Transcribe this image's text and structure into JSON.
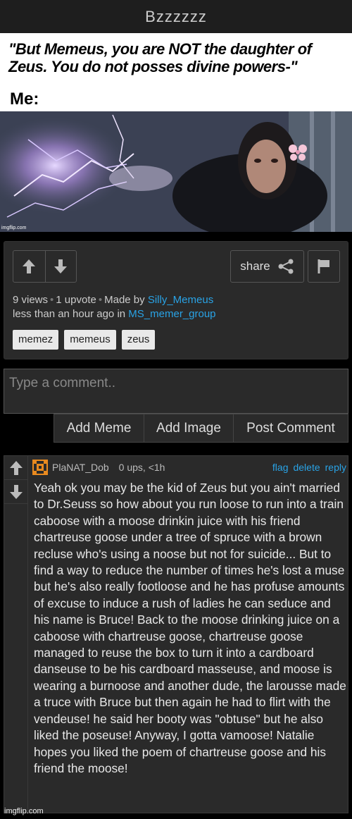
{
  "header": {
    "title": "Bzzzzzz"
  },
  "meme": {
    "caption": "\"But Memeus, you are NOT the daughter of Zeus. You do not posses divine powers-\"",
    "me_label": "Me:",
    "watermark": "imgflip.com"
  },
  "post": {
    "upvote_icon": "arrow-up-icon",
    "downvote_icon": "arrow-down-icon",
    "share_label": "share",
    "views": "9 views",
    "upvotes": "1 upvote",
    "made_by_prefix": "Made by",
    "author": "Silly_Memeus",
    "time_prefix": "less than an hour ago in",
    "group": "MS_memer_group",
    "tags": [
      "memez",
      "memeus",
      "zeus"
    ]
  },
  "comment_form": {
    "placeholder": "Type a comment..",
    "add_meme": "Add Meme",
    "add_image": "Add Image",
    "post_comment": "Post Comment"
  },
  "comment": {
    "username": "PlaNAT_Dob",
    "stats": "0 ups, <1h",
    "flag": "flag",
    "delete": "delete",
    "reply": "reply",
    "text": "Yeah ok you may be the kid of Zeus but you ain't married to Dr.Seuss so how about you run loose to run into a train caboose with a moose drinkin juice with his friend chartreuse goose under a tree of spruce with a brown recluse who's using a noose but not for suicide... But to find a way to reduce the number of times he's lost a muse but he's also really footloose and he has profuse amounts of excuse to induce a rush of ladies he can seduce and his name is Bruce! Back to the moose drinking juice on a caboose with chartreuse goose, chartreuse goose managed to reuse the box to turn it into a cardboard danseuse to be his cardboard masseuse, and moose is wearing a burnoose and another dude, the larousse made a truce with Bruce but then again he had to flirt with the vendeuse! he said her booty was \"obtuse\" but he also liked the poseuse! Anyway, I gotta vamoose! Natalie hopes you liked the poem of chartreuse goose and his friend the moose!"
  },
  "footer": {
    "watermark": "imgflip.com"
  }
}
